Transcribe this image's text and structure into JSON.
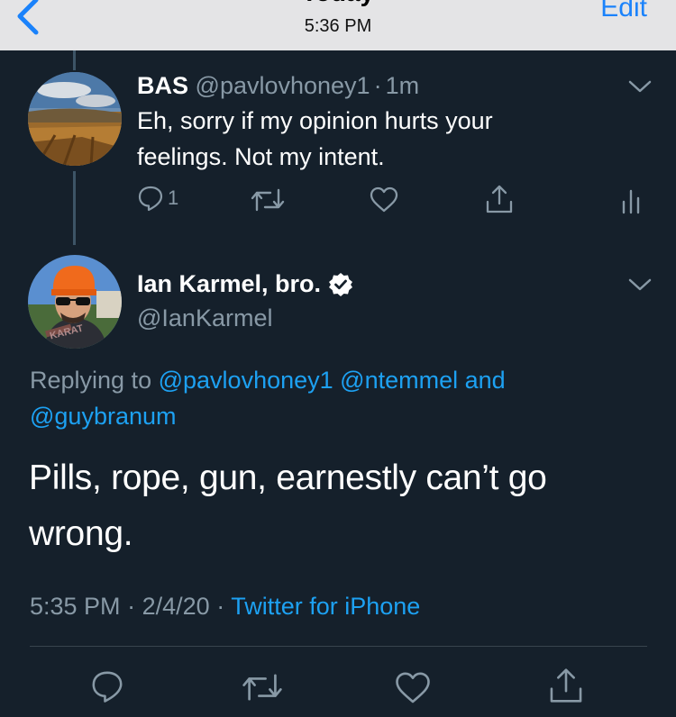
{
  "nav": {
    "heading": "Today",
    "time": "5:36 PM",
    "edit_label": "Edit"
  },
  "reply_tweet": {
    "display_name": "BAS",
    "handle": "@pavlovhoney1",
    "separator": "·",
    "age": "1m",
    "text_line1": "Eh, sorry if my opinion hurts your",
    "text_line2": "feelings. Not my intent.",
    "reply_count": "1"
  },
  "main_tweet": {
    "display_name": "Ian Karmel, bro.",
    "handle": "@IanKarmel",
    "replying_to_label": "Replying to",
    "mention1": "@pavlovhoney1",
    "mention2": "@ntemmel",
    "and_label": "and",
    "mention3": "@guybranum",
    "text_line1": "Pills, rope, gun, earnestly can’t go",
    "text_line2": "wrong.",
    "time": "5:35 PM",
    "separator": "·",
    "date": "2/4/20",
    "source": "Twitter for iPhone",
    "avatar_text": "KARAT"
  },
  "colors": {
    "background": "#15202b",
    "accent": "#1da1f2",
    "muted": "#8899a6",
    "divider": "#38444d"
  },
  "icons": {
    "back": "chevron-left-icon",
    "more": "chevron-down-icon",
    "reply": "speech-bubble-icon",
    "retweet": "retweet-icon",
    "like": "heart-icon",
    "share": "share-icon",
    "analytics": "bar-chart-icon",
    "verified": "verified-badge-icon"
  }
}
